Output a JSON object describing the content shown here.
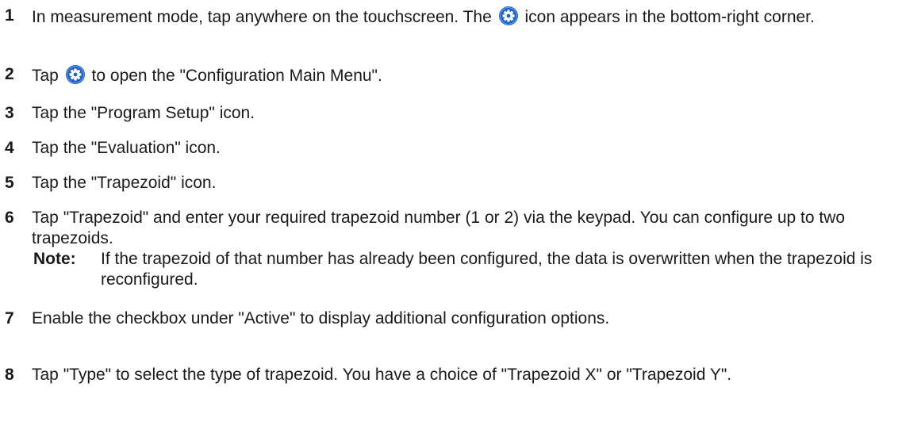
{
  "steps": [
    {
      "num": "1",
      "text_before_icon": "In measurement mode, tap anywhere on the touchscreen. The",
      "icon": "gear-icon",
      "text_after_icon": "icon appears in the bottom-right corner."
    },
    {
      "num": "2",
      "text_before_icon": "Tap",
      "icon": "gear-icon",
      "text_after_icon": "to open the \"Configuration Main Menu\"."
    },
    {
      "num": "3",
      "text": "Tap the \"Program Setup\" icon."
    },
    {
      "num": "4",
      "text": "Tap the \"Evaluation\" icon."
    },
    {
      "num": "5",
      "text": "Tap the \"Trapezoid\" icon."
    },
    {
      "num": "6",
      "text": "Tap \"Trapezoid\" and enter your required trapezoid number (1 or 2) via the keypad. You can configure up to two trapezoids.",
      "note_label": "Note:",
      "note_text": "If the trapezoid of that number has already been configured, the data is overwritten when the trapezoid is reconfigured."
    },
    {
      "num": "7",
      "text": "Enable the checkbox under \"Active\" to display additional configuration options."
    },
    {
      "num": "8",
      "text": "Tap \"Type\" to select the type of trapezoid. You have a choice of \"Trapezoid X\" or \"Trapezoid Y\"."
    }
  ],
  "colors": {
    "icon_fill": "#1e63c6",
    "icon_inner": "#ffffff",
    "text": "#1a1a1a"
  }
}
